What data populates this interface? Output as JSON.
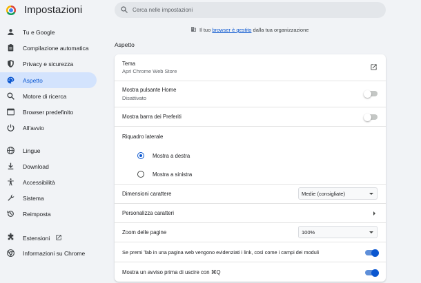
{
  "header": {
    "title": "Impostazioni",
    "search_placeholder": "Cerca nelle impostazioni"
  },
  "sidebar": {
    "items": [
      {
        "label": "Tu e Google",
        "icon": "person-icon"
      },
      {
        "label": "Compilazione automatica",
        "icon": "clipboard-icon"
      },
      {
        "label": "Privacy e sicurezza",
        "icon": "shield-icon"
      },
      {
        "label": "Aspetto",
        "icon": "palette-icon",
        "active": true
      },
      {
        "label": "Motore di ricerca",
        "icon": "search-icon"
      },
      {
        "label": "Browser predefinito",
        "icon": "browser-icon"
      },
      {
        "label": "All'avvio",
        "icon": "power-icon"
      },
      {
        "label": "Lingue",
        "icon": "globe-icon"
      },
      {
        "label": "Download",
        "icon": "download-icon"
      },
      {
        "label": "Accessibilità",
        "icon": "accessibility-icon"
      },
      {
        "label": "Sistema",
        "icon": "wrench-icon"
      },
      {
        "label": "Reimposta",
        "icon": "restore-icon"
      },
      {
        "label": "Estensioni",
        "icon": "puzzle-icon"
      },
      {
        "label": "Informazioni su Chrome",
        "icon": "chrome-icon"
      }
    ]
  },
  "managed_notice": {
    "prefix": "Il tuo ",
    "link": "browser è gestito",
    "suffix": " dalla tua organizzazione"
  },
  "section_title": "Aspetto",
  "settings": {
    "theme_label": "Tema",
    "theme_sub": "Apri Chrome Web Store",
    "home_label": "Mostra pulsante Home",
    "home_sub": "Disattivato",
    "home_enabled": false,
    "bookmarks_label": "Mostra barra dei Preferiti",
    "bookmarks_enabled": false,
    "side_panel_label": "Riquadro laterale",
    "side_panel_options": [
      "Mostra a destra",
      "Mostra a sinistra"
    ],
    "side_panel_selected": "Mostra a destra",
    "font_size_label": "Dimensioni carattere",
    "font_size_value": "Medie (consigliate)",
    "customize_fonts_label": "Personalizza caratteri",
    "zoom_label": "Zoom delle pagine",
    "zoom_value": "100%",
    "tab_highlight_label": "Se premi Tab in una pagina web vengono evidenziati i link, così come i campi dei moduli",
    "tab_highlight_enabled": true,
    "warn_quit_label": "Mostra un avviso prima di uscire con ⌘Q",
    "warn_quit_enabled": true
  },
  "colors": {
    "accent": "#0b57d0",
    "active_nav_bg": "#d3e3fd",
    "page_bg": "#f1f3f6"
  }
}
